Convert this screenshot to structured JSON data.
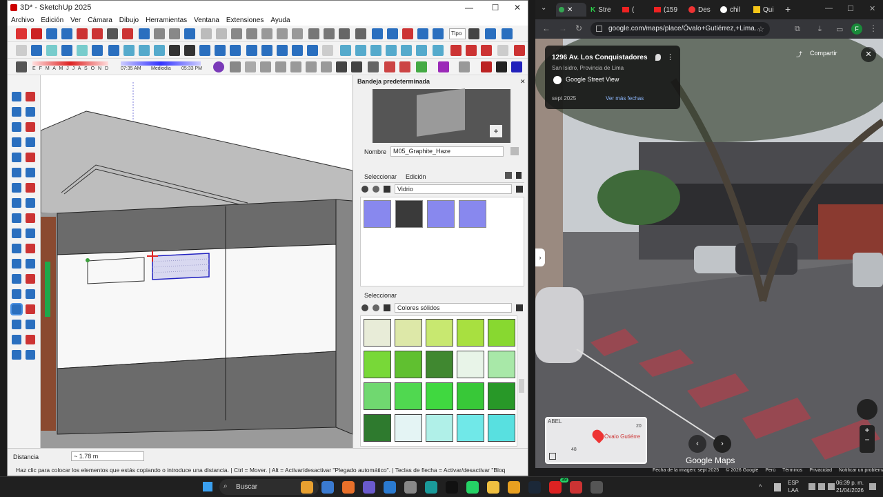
{
  "sketchup": {
    "title": "3D* - SketchUp 2025",
    "menu": [
      "Archivo",
      "Edición",
      "Ver",
      "Cámara",
      "Dibujo",
      "Herramientas",
      "Ventana",
      "Extensiones",
      "Ayuda"
    ],
    "shadow": {
      "months": "E F M A M J J A S O N D",
      "time_start": "07:35 AM",
      "time_mid": "Mediodía",
      "time_end": "05:33 PM"
    },
    "tag_label": "Tipo"
  },
  "tray": {
    "header": "Bandeja predeterminada",
    "name_label": "Nombre",
    "name_value": "M05_Graphite_Haze",
    "tab_select": "Seleccionar",
    "tab_edit": "Edición",
    "library1": "Vidrio",
    "section2": "Seleccionar",
    "library2": "Colores sólidos",
    "glass_swatches": [
      "#8888ee",
      "#3a3a3a",
      "#8888ee",
      "#8888ee"
    ],
    "solid_swatches": [
      "#e8ecd8",
      "#dde8a8",
      "#c8e870",
      "#a8e040",
      "#88d830",
      "#78d838",
      "#60c030",
      "#408830",
      "#e8f4e8",
      "#a8e8a8",
      "#70d870",
      "#50d850",
      "#40d840",
      "#38c838",
      "#289828",
      "#2e7a2e",
      "#e4f4f4",
      "#b0f0e8",
      "#70e8e8",
      "#58e0e0"
    ]
  },
  "status": {
    "distance_label": "Distancia",
    "distance_value": "~ 1.78 m",
    "hint": "Haz clic para colocar los elementos que estás copiando o introduce una distancia. | Ctrl = Mover. | Alt = Activar/desactivar \"Plegado automático\". | Teclas de flecha = Activar/desactivar \"Bloq"
  },
  "chrome": {
    "tabs": [
      "Stre",
      "(",
      "(159",
      "Des",
      "chil",
      "Qui"
    ],
    "url": "google.com/maps/place/Óvalo+Gutiérrez,+Lima...",
    "profile": "F",
    "place_title": "1296 Av. Los Conquistadores",
    "place_sub": "San Isidro, Provincia de Lima",
    "street_view": "Google Street View",
    "date": "sept 2025",
    "more_dates": "Ver más fechas",
    "share": "Compartir",
    "map_label1": "ABEL",
    "map_label2": "Óvalo Gutiérre",
    "map_num1": "20",
    "map_num2": "48",
    "brand": "Google Maps",
    "footer": [
      "Fecha de la imagen: sept 2025",
      "© 2026 Google",
      "Perú",
      "Términos",
      "Privacidad",
      "Notificar un problema"
    ]
  },
  "taskbar": {
    "search": "Buscar",
    "lang1": "ESP",
    "lang2": "LAA",
    "time": "06:39 p. m.",
    "date": "21/04/2026",
    "badge": "39"
  }
}
